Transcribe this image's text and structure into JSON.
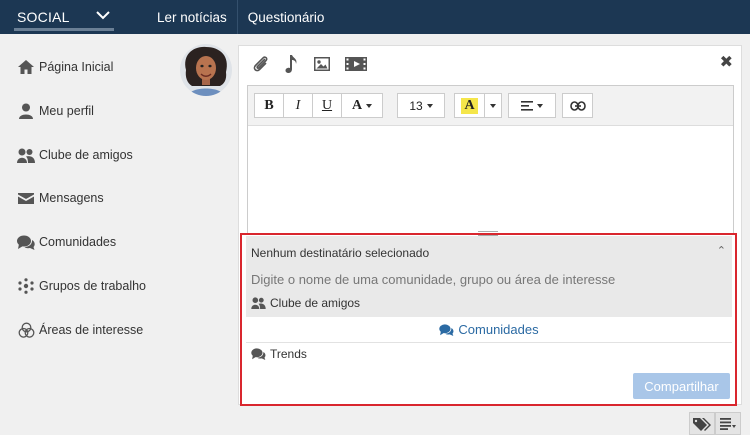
{
  "topbar": {
    "brand": "SOCIAL",
    "links": [
      "Ler notícias",
      "Questionário"
    ]
  },
  "sidebar": {
    "items": [
      {
        "label": "Página Inicial",
        "icon": "home-icon"
      },
      {
        "label": "Meu perfil",
        "icon": "user-icon"
      },
      {
        "label": "Clube de amigos",
        "icon": "friends-icon"
      },
      {
        "label": "Mensagens",
        "icon": "envelope-icon"
      },
      {
        "label": "Comunidades",
        "icon": "comments-icon"
      },
      {
        "label": "Grupos de trabalho",
        "icon": "network-icon"
      },
      {
        "label": "Áreas de interesse",
        "icon": "interest-icon"
      }
    ]
  },
  "editor": {
    "bold": "B",
    "italic": "I",
    "underline": "U",
    "font_color": "A",
    "font_size": "13",
    "highlight": "A"
  },
  "recipients": {
    "title": "Nenhum destinatário selecionado",
    "placeholder": "Digite o nome de uma comunidade, grupo ou área de interesse",
    "friends": "Clube de amigos",
    "communities": "Comunidades",
    "trends": "Trends"
  },
  "share_label": "Compartilhar",
  "colors": {
    "topbar": "#1c3753",
    "accent": "#2b6aa3",
    "share_button": "#a9c6e8",
    "highlight_border": "#d9262e",
    "highlight_fill": "#f5e64a"
  }
}
